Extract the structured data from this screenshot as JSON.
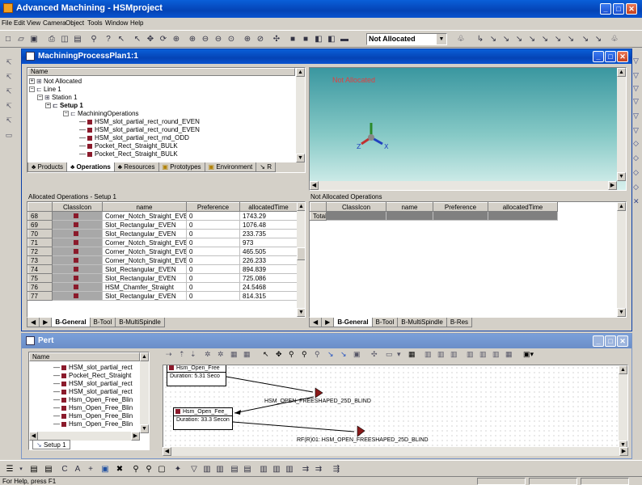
{
  "app": {
    "title": "Advanced Machining - HSMproject"
  },
  "menu": [
    "File",
    "Edit",
    "View",
    "Camera",
    "Object",
    "Tools",
    "Window",
    "Help"
  ],
  "toolbar": {
    "allocation_select": "Not Allocated"
  },
  "plan_window": {
    "title": "MachiningProcessPlan1:1",
    "tree_header": "Name",
    "tree": [
      {
        "label": "Not Allocated",
        "indent": 0,
        "bold": false
      },
      {
        "label": "Line 1",
        "indent": 1,
        "bold": false
      },
      {
        "label": "Station 1",
        "indent": 2,
        "bold": false
      },
      {
        "label": "Setup 1",
        "indent": 3,
        "bold": true
      },
      {
        "label": "MachiningOperations",
        "indent": 4,
        "bold": false
      },
      {
        "label": "HSM_slot_partial_rect_round_EVEN",
        "indent": 5,
        "bold": false
      },
      {
        "label": "HSM_slot_partial_rect_round_EVEN",
        "indent": 5,
        "bold": false
      },
      {
        "label": "HSM_slot_partial_rect_rnd_ODD",
        "indent": 5,
        "bold": false
      },
      {
        "label": "Pocket_Rect_Straight_BULK",
        "indent": 5,
        "bold": false
      },
      {
        "label": "Pocket_Rect_Straight_BULK",
        "indent": 5,
        "bold": false
      }
    ],
    "tree_tabs": [
      "Products",
      "Operations",
      "Resources",
      "Prototypes",
      "Environment",
      "R"
    ],
    "viewport_label": "Not Allocated"
  },
  "allocated": {
    "title": "Allocated Operations - Setup 1",
    "columns": [
      "ClassIcon",
      "name",
      "Preference",
      "allocatedTime"
    ],
    "rows": [
      {
        "id": "68",
        "name": "Corner_Notch_Straight_EVEN",
        "pref": "0",
        "time": "1743.29"
      },
      {
        "id": "69",
        "name": "Slot_Rectangular_EVEN",
        "pref": "0",
        "time": "1076.48"
      },
      {
        "id": "70",
        "name": "Slot_Rectangular_EVEN",
        "pref": "0",
        "time": "233.735"
      },
      {
        "id": "71",
        "name": "Corner_Notch_Straight_EVEN",
        "pref": "0",
        "time": "973"
      },
      {
        "id": "72",
        "name": "Corner_Notch_Straight_EVEN",
        "pref": "0",
        "time": "465.505"
      },
      {
        "id": "73",
        "name": "Corner_Notch_Straight_EVEN",
        "pref": "0",
        "time": "226.233"
      },
      {
        "id": "74",
        "name": "Slot_Rectangular_EVEN",
        "pref": "0",
        "time": "894.839"
      },
      {
        "id": "75",
        "name": "Slot_Rectangular_EVEN",
        "pref": "0",
        "time": "725.086"
      },
      {
        "id": "76",
        "name": "HSM_Chamfer_Straight",
        "pref": "0",
        "time": "24.5468"
      },
      {
        "id": "77",
        "name": "Slot_Rectangular_EVEN",
        "pref": "0",
        "time": "814.315"
      }
    ],
    "tabs": [
      "B-General",
      "B-Tool",
      "B-MultiSpindle"
    ]
  },
  "not_allocated": {
    "title": "Not Allocated Operations",
    "columns": [
      "ClassIcon",
      "name",
      "Preference",
      "allocatedTime"
    ],
    "total_label": "Total",
    "tabs": [
      "B-General",
      "B-Tool",
      "B-MultiSpindle",
      "B-Res"
    ]
  },
  "pert": {
    "title": "Pert",
    "tree_header": "Name",
    "tree": [
      "HSM_slot_partial_rect",
      "Pocket_Rect_Straight",
      "HSM_slot_partial_rect",
      "HSM_slot_partial_rect",
      "Hsm_Open_Free_Blin",
      "Hsm_Open_Free_Blin",
      "Hsm_Open_Free_Blin",
      "Hsm_Open_Free_Blin"
    ],
    "tab": "Setup 1",
    "nodes": [
      {
        "title": "Hsm_Open_Free",
        "duration": "Duration: 5.31 Seco"
      },
      {
        "title": "Hsm_Open_Fee_",
        "duration": "Duration: 33.3 Secon"
      }
    ],
    "labels": [
      "HSM_OPEN_FREESHAPED_25D_BLIND",
      "RF(R)01: HSM_OPEN_FREESHAPED_25D_BLIND"
    ]
  },
  "status": {
    "text": "For Help, press F1"
  }
}
